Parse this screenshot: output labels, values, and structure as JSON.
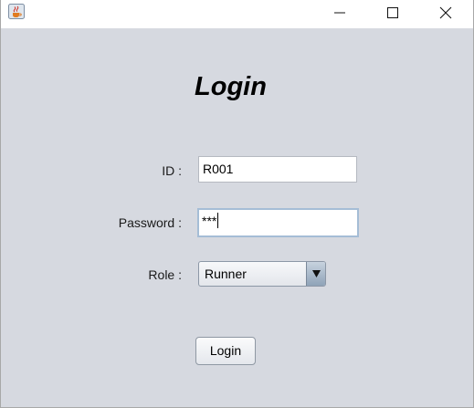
{
  "window": {
    "app_icon": "java-coffee-icon",
    "controls": {
      "minimize_icon": "minimize-icon",
      "maximize_icon": "maximize-icon",
      "close_icon": "close-icon"
    }
  },
  "form": {
    "title": "Login",
    "id_label": "ID :",
    "id_value": "R001",
    "password_label": "Password :",
    "password_masked": "***",
    "role_label": "Role :",
    "role_selected": "Runner",
    "submit_label": "Login"
  },
  "colors": {
    "background": "#d6d9e0",
    "titlebar": "#ffffff",
    "focus_border": "#a5bdd6"
  }
}
